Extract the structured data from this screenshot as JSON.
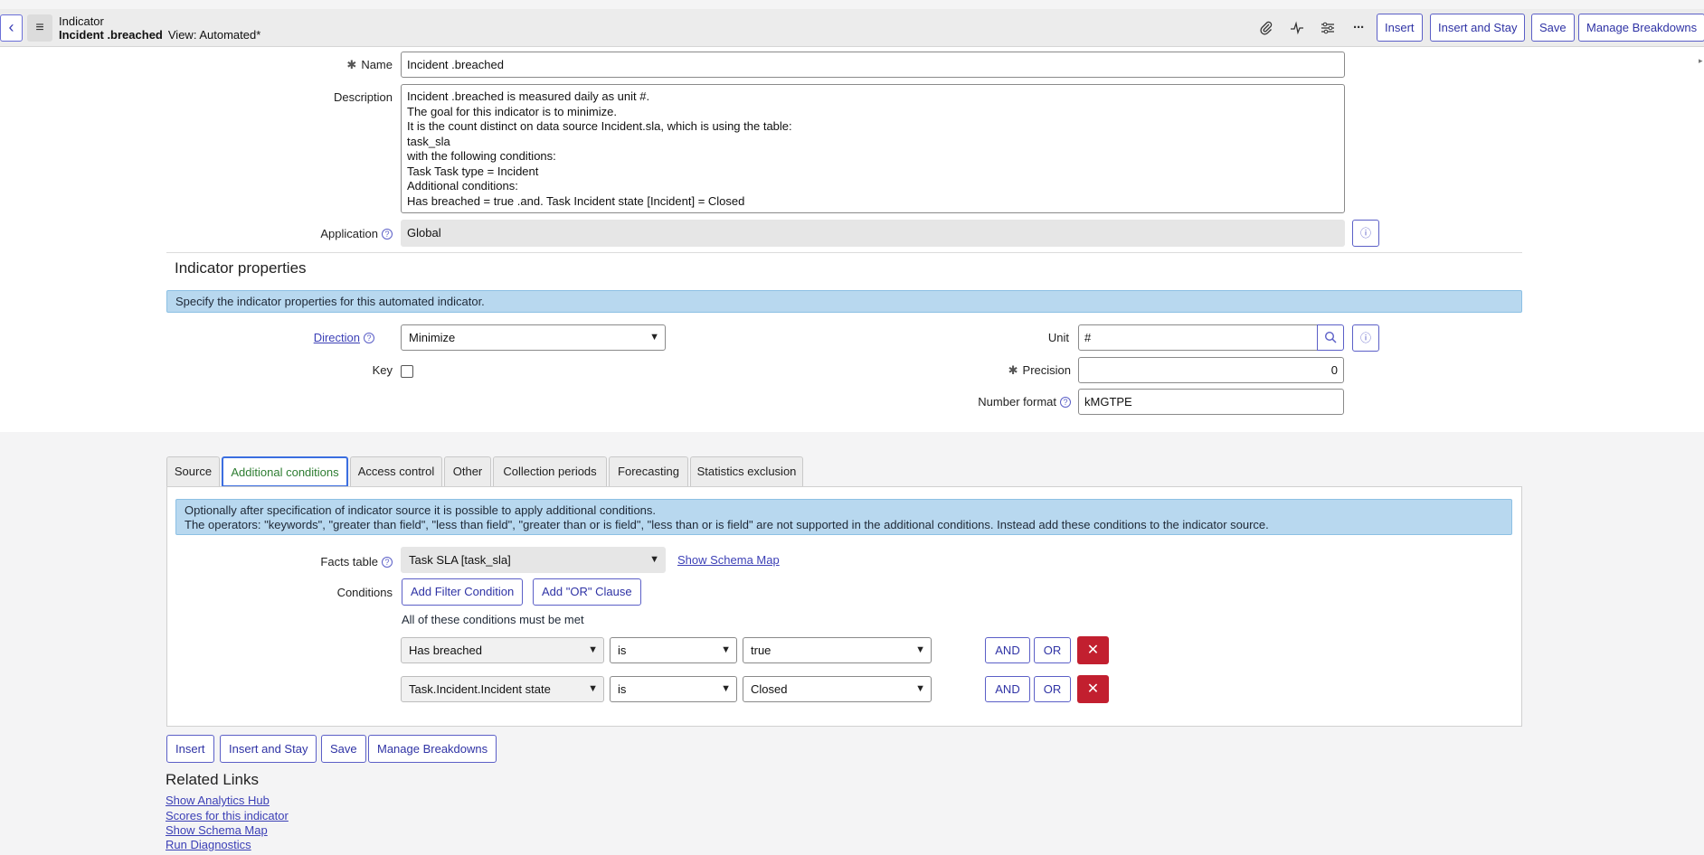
{
  "header": {
    "back_icon": "‹",
    "menu_icon": "≡",
    "title": "Indicator",
    "record_name": "Incident .breached",
    "view": "View: Automated*",
    "icons": {
      "attachment": "paperclip-icon",
      "activity": "activity-icon",
      "settings": "sliders-icon",
      "more": "more-icon"
    },
    "buttons": {
      "insert": "Insert",
      "insert_and_stay": "Insert and Stay",
      "save": "Save",
      "manage_breakdowns": "Manage Breakdowns"
    }
  },
  "form": {
    "name": {
      "label": "Name",
      "value": "Incident .breached"
    },
    "description": {
      "label": "Description",
      "lines": [
        "Incident .breached is measured daily as unit #.",
        "The goal for this indicator is to minimize.",
        "It is the count distinct on data source Incident.sla, which is using the table:",
        "task_sla",
        "with the following conditions:",
        "Task Task type = Incident",
        "Additional conditions:",
        "Has breached = true .and. Task Incident state [Incident] = Closed"
      ]
    },
    "application": {
      "label": "Application",
      "value": "Global"
    }
  },
  "indicator_properties": {
    "title": "Indicator properties",
    "banner": "Specify the indicator properties for this automated indicator.",
    "direction": {
      "label": "Direction",
      "value": "Minimize"
    },
    "key": {
      "label": "Key",
      "checked": false
    },
    "unit": {
      "label": "Unit",
      "value": "#"
    },
    "precision": {
      "label": "Precision",
      "value": "0"
    },
    "number_format": {
      "label": "Number format",
      "value": "kMGTPE"
    }
  },
  "tabs": [
    {
      "label": "Source",
      "active": false
    },
    {
      "label": "Additional conditions",
      "active": true
    },
    {
      "label": "Access control",
      "active": false
    },
    {
      "label": "Other",
      "active": false
    },
    {
      "label": "Collection periods",
      "active": false
    },
    {
      "label": "Forecasting",
      "active": false
    },
    {
      "label": "Statistics exclusion",
      "active": false
    }
  ],
  "additional_conditions": {
    "banner_line1": "Optionally after specification of indicator source it is possible to apply additional conditions.",
    "banner_line2": "The operators: \"keywords\", \"greater than field\", \"less than field\", \"greater than or is field\", \"less than or is field\" are not supported in the additional conditions. Instead add these conditions to the indicator source.",
    "facts_table": {
      "label": "Facts table",
      "value": "Task SLA [task_sla]",
      "schema_link": "Show Schema Map"
    },
    "conditions_label": "Conditions",
    "add_filter_condition": "Add Filter Condition",
    "add_or_clause": "Add \"OR\" Clause",
    "must_be_met": "All of these conditions must be met",
    "rows": [
      {
        "field": "Has breached",
        "operator": "is",
        "value": "true",
        "and": "AND",
        "or": "OR",
        "delete_icon": "✕"
      },
      {
        "field": "Task.Incident.Incident state",
        "operator": "is",
        "value": "Closed",
        "and": "AND",
        "or": "OR",
        "delete_icon": "✕"
      }
    ]
  },
  "bottom_buttons": {
    "insert": "Insert",
    "insert_and_stay": "Insert and Stay",
    "save": "Save",
    "manage_breakdowns": "Manage Breakdowns"
  },
  "related_links": {
    "title": "Related Links",
    "links": [
      "Show Analytics Hub",
      "Scores for this indicator",
      "Show Schema Map",
      "Run Diagnostics"
    ]
  }
}
